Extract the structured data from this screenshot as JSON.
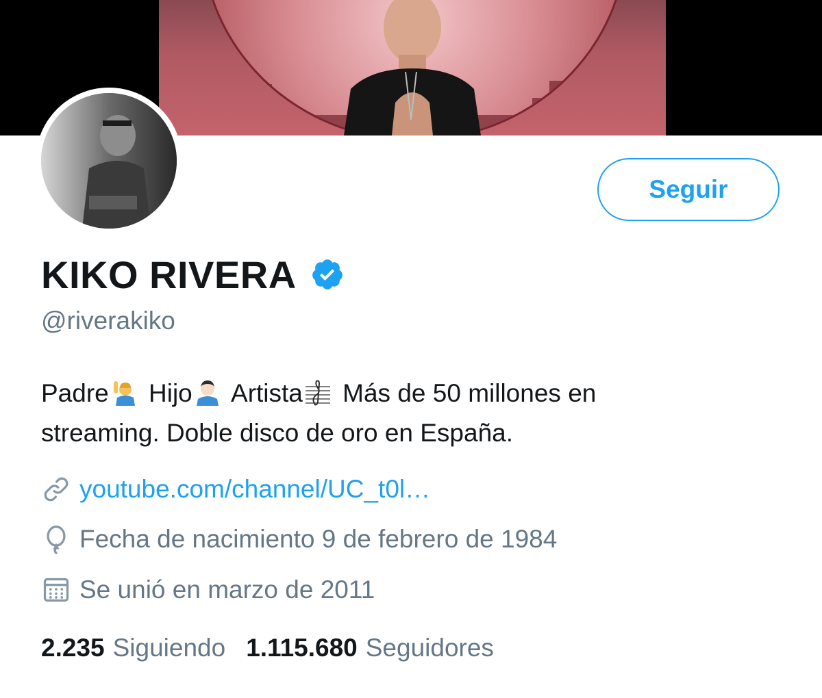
{
  "profile": {
    "display_name": "KIKO RIVERA",
    "handle": "@riverakiko",
    "verified": true,
    "follow_label": "Seguir",
    "bio": {
      "word1": "Padre",
      "word2": "Hijo",
      "word3": "Artista",
      "rest_line1": "Más de 50 millones en",
      "line2": "streaming. Doble disco de oro en España."
    },
    "website": "youtube.com/channel/UC_t0l…",
    "birth": "Fecha de nacimiento 9 de febrero de 1984",
    "joined": "Se unió en marzo de 2011",
    "stats": {
      "following_count": "2.235",
      "following_label": "Siguiendo",
      "followers_count": "1.115.680",
      "followers_label": "Seguidores"
    }
  },
  "icons": {
    "verified": "verified-badge-icon",
    "link": "link-icon",
    "birth": "balloon-icon",
    "joined": "calendar-icon"
  },
  "colors": {
    "accent": "#1da1f2",
    "text": "#14171a",
    "secondary": "#657786"
  }
}
